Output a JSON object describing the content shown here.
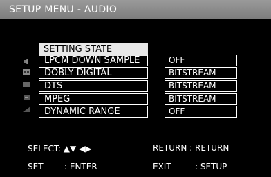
{
  "header": {
    "title": "SETUP MENU - AUDIO"
  },
  "menu": {
    "heading": "SETTING STATE",
    "items": [
      {
        "label": "LPCM DOWN SAMPLE",
        "value": "OFF"
      },
      {
        "label": "DOBLY DIGITAL",
        "value": "BITSTREAM"
      },
      {
        "label": "DTS",
        "value": "BITSTREAM"
      },
      {
        "label": "MPEG",
        "value": "BITSTREAM"
      },
      {
        "label": "DYNAMIC RANGE",
        "value": "OFF"
      }
    ]
  },
  "footer": {
    "select_label": "SELECT:",
    "select_arrows": "▲▼ ◀▶",
    "return_label": "RETURN : RETURN",
    "set_label": "SET",
    "set_action": ": ENTER",
    "exit_label": "EXIT",
    "exit_action": ": SETUP"
  },
  "icons": [
    "speaker-icon",
    "dolby-icon",
    "dts-icon",
    "mpeg-icon",
    "range-icon"
  ]
}
